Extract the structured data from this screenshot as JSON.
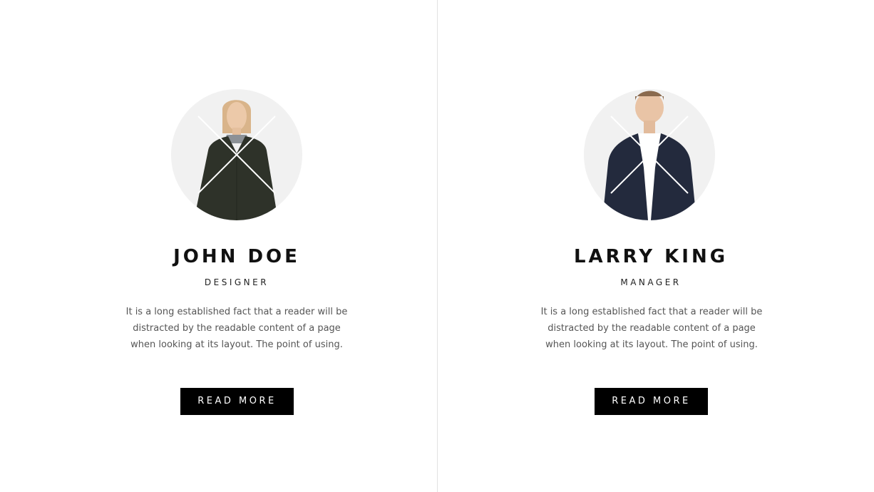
{
  "team": [
    {
      "name": "JOHN DOE",
      "role": "DESIGNER",
      "description": "It is a long established fact that a reader will be distracted by the readable content of a page when looking at its layout. The point of using.",
      "button_label": "READ MORE",
      "photo": "woman-dark-green-coat-portrait",
      "garment_color": "#2e3229"
    },
    {
      "name": "LARRY KING",
      "role": "MANAGER",
      "description": "It is a long established fact that a reader will be distracted by the readable content of a page when looking at its layout. The point of using.",
      "button_label": "READ MORE",
      "photo": "man-navy-bomber-jacket-portrait",
      "garment_color": "#232a3d"
    }
  ],
  "colors": {
    "background": "#ffffff",
    "avatar_bg": "#f1f1f1",
    "button_bg": "#000000",
    "button_text": "#ffffff",
    "divider": "#e2e2e2"
  }
}
